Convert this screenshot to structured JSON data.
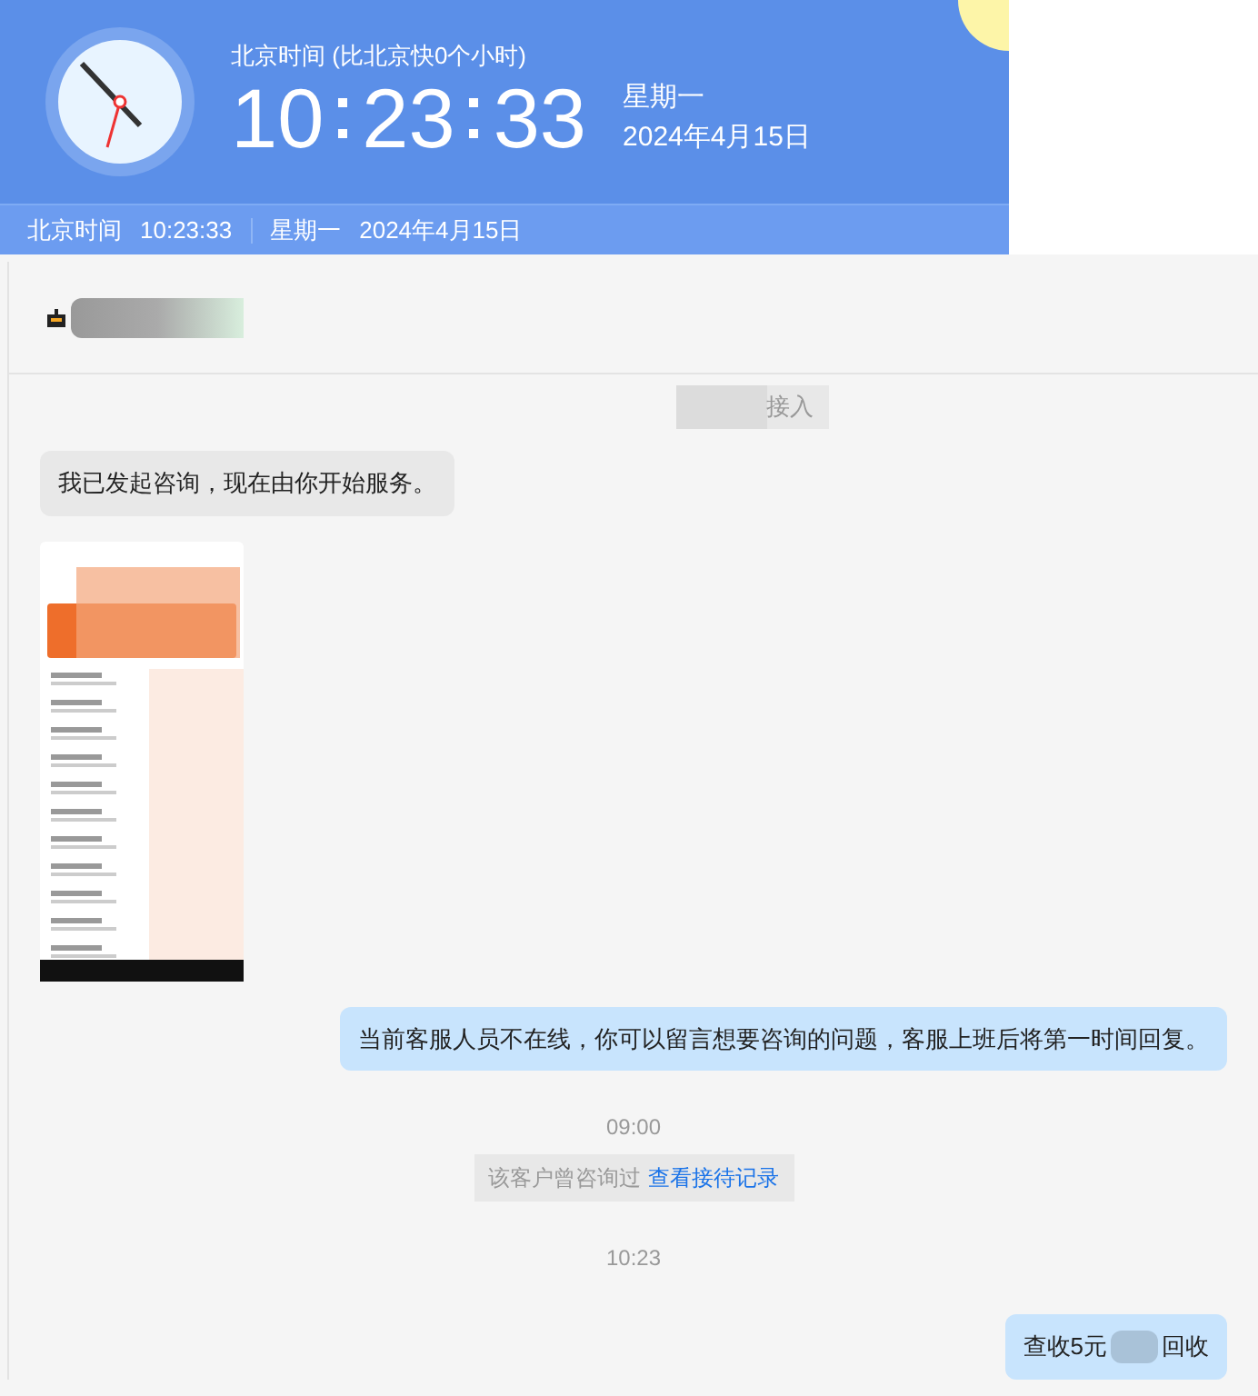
{
  "clock_widget": {
    "caption": "北京时间 (比北京快0个小时)",
    "time_hours": "10",
    "time_minutes": "23",
    "time_seconds": "33",
    "weekday": "星期一",
    "date": "2024年4月15日"
  },
  "clock_bar": {
    "label": "北京时间",
    "time": "10:23:33",
    "weekday": "星期一",
    "date": "2024年4月15日"
  },
  "chat": {
    "messages": [
      {
        "kind": "system",
        "suffix": "接入"
      },
      {
        "kind": "incoming",
        "text": "我已发起咨询，现在由你开始服务。"
      },
      {
        "kind": "image"
      },
      {
        "kind": "outgoing",
        "text": "当前客服人员不在线，你可以留言想要咨询的问题，客服上班后将第一时间回复。"
      },
      {
        "kind": "time",
        "text": "09:00"
      },
      {
        "kind": "notice",
        "text": "该客户曾咨询过",
        "link": "查看接待记录"
      },
      {
        "kind": "time",
        "text": "10:23"
      },
      {
        "kind": "outgoing_redacted",
        "before": "查收5元",
        "after": "回收"
      }
    ]
  }
}
